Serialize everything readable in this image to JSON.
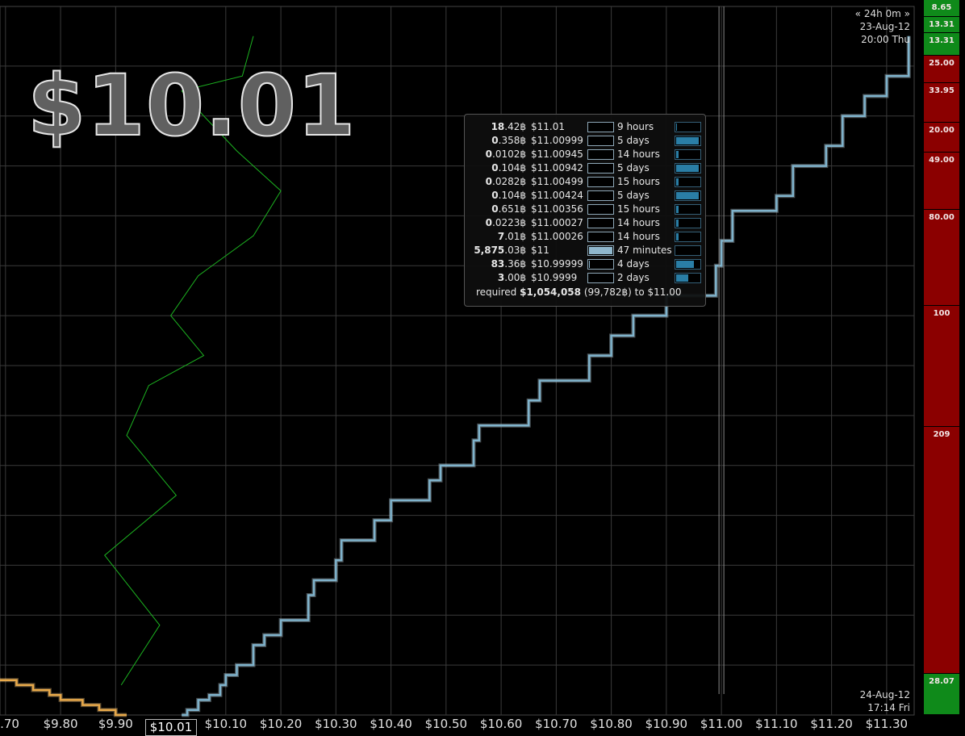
{
  "big_price": "$10.01",
  "current_price_box": "$10.01",
  "time_top": {
    "span": "« 24h 0m »",
    "date": "23-Aug-12",
    "time": "20:00 Thu"
  },
  "time_bottom": {
    "date": "24-Aug-12",
    "time": "17:14 Fri"
  },
  "x_ticks": [
    {
      "label": ".70",
      "value": 9.7
    },
    {
      "label": "$9.80",
      "value": 9.8
    },
    {
      "label": "$9.90",
      "value": 9.9
    },
    {
      "label": "$10.10",
      "value": 10.1
    },
    {
      "label": "$10.20",
      "value": 10.2
    },
    {
      "label": "$10.30",
      "value": 10.3
    },
    {
      "label": "$10.40",
      "value": 10.4
    },
    {
      "label": "$10.50",
      "value": 10.5
    },
    {
      "label": "$10.60",
      "value": 10.6
    },
    {
      "label": "$10.70",
      "value": 10.7
    },
    {
      "label": "$10.80",
      "value": 10.8
    },
    {
      "label": "$10.90",
      "value": 10.9
    },
    {
      "label": "$11.00",
      "value": 11.0
    },
    {
      "label": "$11.10",
      "value": 11.1
    },
    {
      "label": "$11.20",
      "value": 11.2
    },
    {
      "label": "$11.30",
      "value": 11.3
    }
  ],
  "sidebar": [
    {
      "label": "8.65",
      "color": "#0f8a1a",
      "from": 0.0,
      "to": 0.024
    },
    {
      "label": "13.31",
      "color": "#0f8a1a",
      "from": 0.024,
      "to": 0.046
    },
    {
      "label": "13.31",
      "color": "#0f8a1a",
      "from": 0.046,
      "to": 0.078
    },
    {
      "label": "25.00",
      "color": "#8b0000",
      "from": 0.078,
      "to": 0.116
    },
    {
      "label": "33.95",
      "color": "#8b0000",
      "from": 0.116,
      "to": 0.172
    },
    {
      "label": "20.00",
      "color": "#8b0000",
      "from": 0.172,
      "to": 0.213
    },
    {
      "label": "49.00",
      "color": "#8b0000",
      "from": 0.213,
      "to": 0.293
    },
    {
      "label": "80.00",
      "color": "#8b0000",
      "from": 0.293,
      "to": 0.428
    },
    {
      "label": "100",
      "color": "#8b0000",
      "from": 0.428,
      "to": 0.597
    },
    {
      "label": "209",
      "color": "#8b0000",
      "from": 0.597,
      "to": 0.942
    },
    {
      "label": "28.07",
      "color": "#0f8a1a",
      "from": 0.942,
      "to": 1.0
    }
  ],
  "tooltip": {
    "rows": [
      {
        "amt_int": "18",
        "amt_frac": ".42฿",
        "price": "$11.01",
        "bar": 0.0,
        "time": "9 hours",
        "age": 0.05
      },
      {
        "amt_int": "0",
        "amt_frac": ".358฿",
        "price": "$11.00999",
        "bar": 0.0,
        "time": "5 days",
        "age": 0.95
      },
      {
        "amt_int": "0",
        "amt_frac": ".0102฿",
        "price": "$11.00945",
        "bar": 0.0,
        "time": "14 hours",
        "age": 0.12
      },
      {
        "amt_int": "0",
        "amt_frac": ".104฿",
        "price": "$11.00942",
        "bar": 0.0,
        "time": "5 days",
        "age": 0.95
      },
      {
        "amt_int": "0",
        "amt_frac": ".0282฿",
        "price": "$11.00499",
        "bar": 0.0,
        "time": "15 hours",
        "age": 0.12
      },
      {
        "amt_int": "0",
        "amt_frac": ".104฿",
        "price": "$11.00424",
        "bar": 0.0,
        "time": "5 days",
        "age": 0.95
      },
      {
        "amt_int": "0",
        "amt_frac": ".651฿",
        "price": "$11.00356",
        "bar": 0.0,
        "time": "15 hours",
        "age": 0.12
      },
      {
        "amt_int": "0",
        "amt_frac": ".0223฿",
        "price": "$11.00027",
        "bar": 0.0,
        "time": "14 hours",
        "age": 0.12
      },
      {
        "amt_int": "7",
        "amt_frac": ".01฿",
        "price": "$11.00026",
        "bar": 0.0,
        "time": "14 hours",
        "age": 0.12
      },
      {
        "amt_int": "5,875",
        "amt_frac": ".03฿",
        "price": "$11",
        "bar": 1.0,
        "time": "47 minutes",
        "age": 0.0
      },
      {
        "amt_int": "83",
        "amt_frac": ".36฿",
        "price": "$10.99999",
        "bar": 0.01,
        "time": "4 days",
        "age": 0.75
      },
      {
        "amt_int": "3",
        "amt_frac": ".00฿",
        "price": "$10.9999",
        "bar": 0.0,
        "time": "2 days",
        "age": 0.5
      }
    ],
    "summary_prefix": "required ",
    "summary_amount": "$1,054,058",
    "summary_suffix": " (99,782฿) to $11.00"
  },
  "chart_data": {
    "type": "line",
    "title": "",
    "xlabel": "",
    "ylabel": "",
    "x_range": [
      9.69,
      11.35
    ],
    "x_ticks": [
      9.7,
      9.8,
      9.9,
      10.1,
      10.2,
      10.3,
      10.4,
      10.5,
      10.6,
      10.7,
      10.8,
      10.9,
      11.0,
      11.1,
      11.2,
      11.3
    ],
    "current_price": 10.01,
    "grid": true,
    "series": [
      {
        "color": "#7fb3cc",
        "x": [
          10.02,
          10.03,
          10.05,
          10.07,
          10.09,
          10.1,
          10.12,
          10.15,
          10.17,
          10.2,
          10.25,
          10.26,
          10.3,
          10.31,
          10.37,
          10.4,
          10.47,
          10.49,
          10.55,
          10.56,
          10.65,
          10.67,
          10.76,
          10.8,
          10.84,
          10.9,
          10.99,
          11.0,
          11.02,
          11.1,
          11.13,
          11.19,
          11.22,
          11.26,
          11.3,
          11.34
        ],
        "y": [
          0,
          1,
          3,
          4,
          6,
          8,
          10,
          14,
          16,
          19,
          24,
          27,
          31,
          35,
          39,
          43,
          47,
          50,
          55,
          58,
          63,
          67,
          72,
          76,
          80,
          84,
          90,
          95,
          101,
          104,
          110,
          114,
          120,
          124,
          128,
          136
        ]
      },
      {
        "color": "#e8a94a",
        "x": [
          9.69,
          9.72,
          9.75,
          9.78,
          9.8,
          9.84,
          9.87,
          9.9,
          9.92
        ],
        "y": [
          7,
          6,
          5,
          4,
          3,
          2,
          1,
          0,
          0
        ]
      },
      {
        "color": "#1cb320",
        "x": [
          10.15,
          10.13,
          10.02,
          10.06,
          10.12,
          10.2,
          10.15,
          10.05,
          10.0,
          10.06,
          9.96,
          9.92,
          10.01,
          9.88,
          9.98,
          9.91
        ],
        "y": [
          136,
          128,
          125,
          120,
          113,
          105,
          96,
          88,
          80,
          72,
          66,
          56,
          44,
          32,
          18,
          6
        ]
      }
    ]
  }
}
